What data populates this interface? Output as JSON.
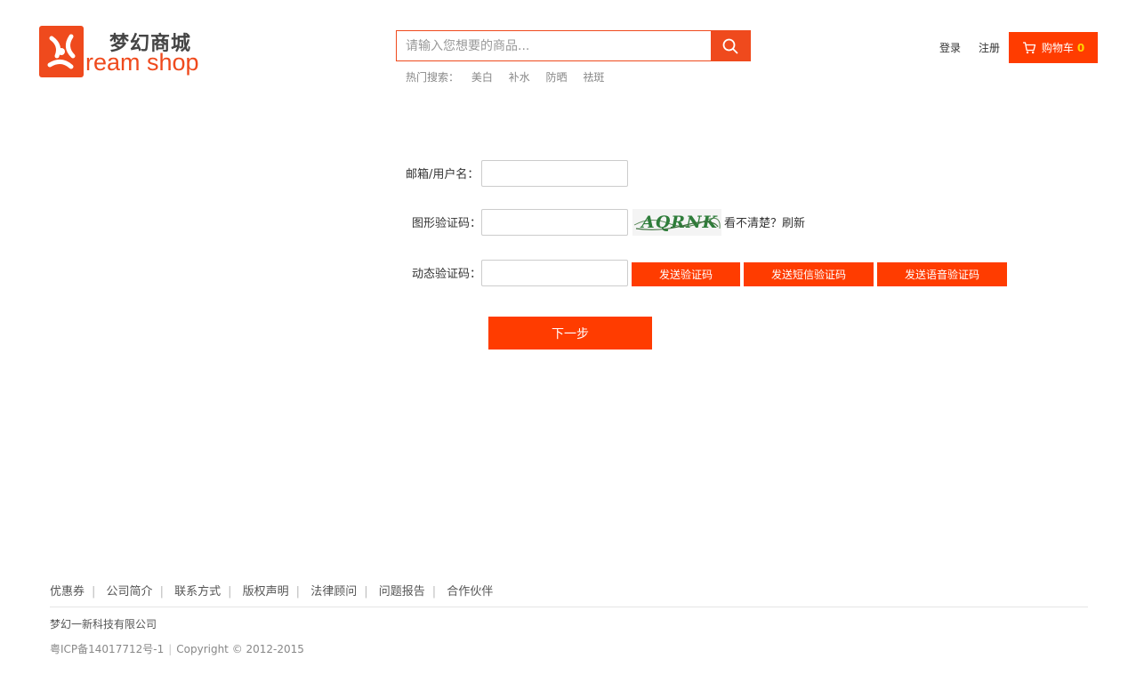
{
  "header": {
    "logo_cn": "梦幻商城",
    "logo_en": "ream shop",
    "search": {
      "placeholder": "请输入您想要的商品..."
    },
    "hot_search": {
      "label": "热门搜索：",
      "items": [
        "美白",
        "补水",
        "防晒",
        "祛斑"
      ]
    },
    "login": "登录",
    "register": "注册",
    "cart": {
      "label": "购物车",
      "count": "0"
    },
    "brand_color": "#ef4a1d"
  },
  "form": {
    "username_label": "邮箱/用户名：",
    "captcha_label": "图形验证码：",
    "captcha_text": "AQRNK",
    "captcha_tip": "看不清楚？",
    "captcha_refresh": "刷新",
    "dynamic_label": "动态验证码：",
    "send_code": "发送验证码",
    "send_sms": "发送短信验证码",
    "send_voice": "发送语音验证码",
    "next": "下一步",
    "button_color": "#ff3c00"
  },
  "footer": {
    "links": [
      "优惠券",
      "公司简介",
      "联系方式",
      "版权声明",
      "法律顾问",
      "问题报告",
      "合作伙伴"
    ],
    "company": "梦幻一新科技有限公司",
    "icp": "粤ICP备14017712号-1",
    "copyright": "Copyright © 2012-2015"
  }
}
